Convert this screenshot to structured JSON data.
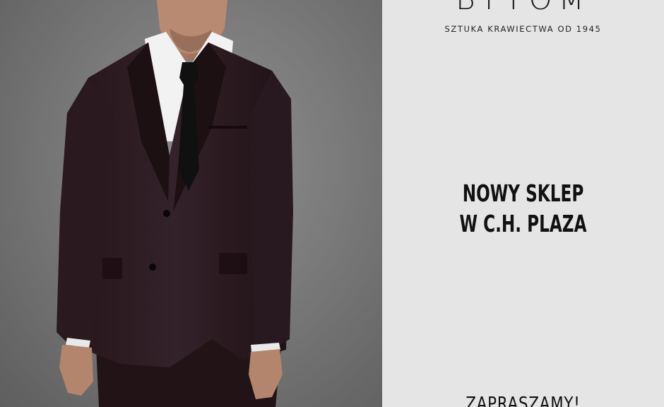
{
  "brand": {
    "name": "BYTOM",
    "tagline": "SZTUKA KRAWIECTWA OD 1945"
  },
  "headline": {
    "line1": "NOWY SKLEP",
    "line2": "W C.H. PLAZA"
  },
  "cta": {
    "text": "ZAPRASZAMY!"
  },
  "photo": {
    "subject": "man-in-suit-photo",
    "suit_color": "#2a1b1f"
  }
}
